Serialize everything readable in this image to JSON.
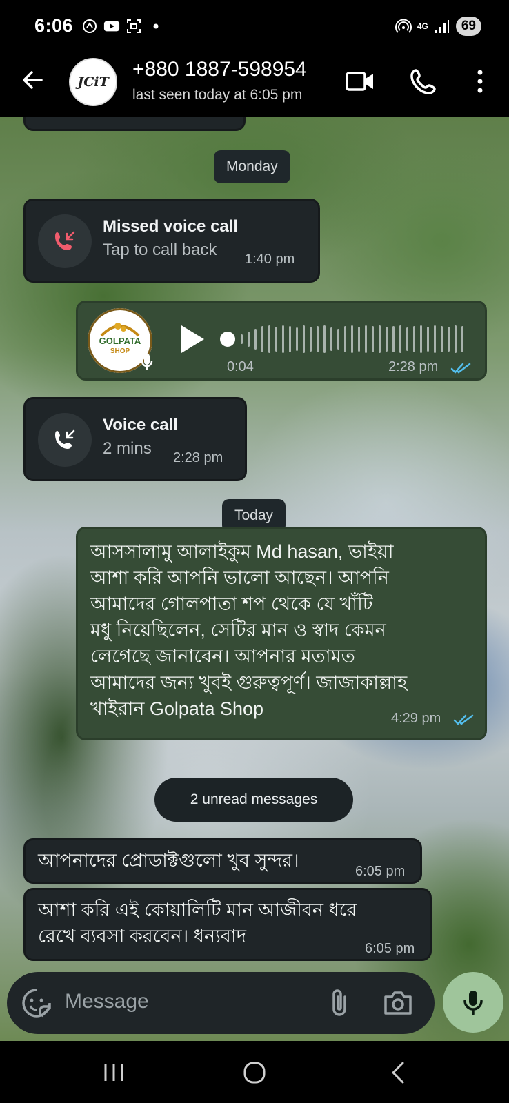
{
  "status_bar": {
    "time": "6:06",
    "battery": "69",
    "network": "4G"
  },
  "header": {
    "avatar_text": "JCiT",
    "contact_name": "+880 1887-598954",
    "last_seen": "last seen today at 6:05 pm"
  },
  "chat": {
    "day_monday": "Monday",
    "missed_call": {
      "title": "Missed voice call",
      "subtitle": "Tap to call back",
      "time": "1:40 pm"
    },
    "voice_note": {
      "avatar_line1": "GOLPATA",
      "avatar_line2": "SHOP",
      "duration": "0:04",
      "time": "2:28 pm"
    },
    "voice_call": {
      "title": "Voice call",
      "subtitle": "2 mins",
      "time": "2:28 pm"
    },
    "day_today": "Today",
    "outgoing_message": {
      "line1": "আসসালামু আলাইকুম Md hasan, ভাইয়া",
      "line2": "আশা করি আপনি ভালো আছেন। আপনি",
      "line3": "আমাদের গোলপাতা শপ থেকে যে খাঁটি",
      "line4": "মধু নিয়েছিলেন, সেটির মান ও স্বাদ কেমন",
      "line5": "লেগেছে জানাবেন। আপনার মতামত",
      "line6": "আমাদের জন্য খুবই গুরুত্বপূর্ণ। জাজাকাল্লাহ",
      "line7": "খাইরান Golpata Shop",
      "time": "4:29 pm"
    },
    "unread_label": "2 unread messages",
    "incoming_1": {
      "text": "আপনাদের প্রোডাক্টগুলো খুব সুন্দর।",
      "time": "6:05 pm"
    },
    "incoming_2": {
      "line1": "আশা করি এই কোয়ালিটি মান আজীবন ধরে",
      "line2": "রেখে ব্যবসা করবেন। ধন্যবাদ",
      "time": "6:05 pm"
    }
  },
  "input": {
    "placeholder": "Message"
  },
  "colors": {
    "outgoing_bubble": "#364c36",
    "incoming_bubble": "#1f2528",
    "missed_call_red": "#f15c6d",
    "read_ticks": "#53bdeb",
    "mic_button": "#9fc59b"
  }
}
